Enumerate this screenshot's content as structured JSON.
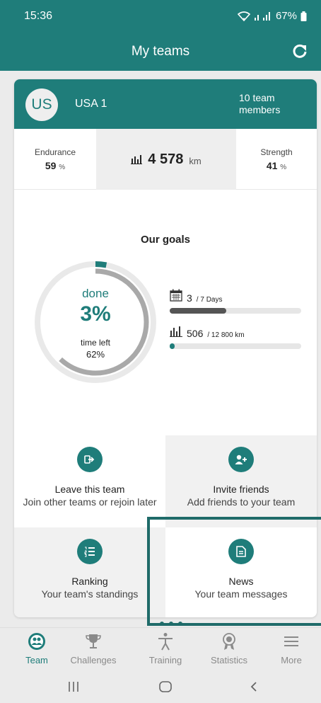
{
  "status_bar": {
    "time": "15:36",
    "battery": "67%"
  },
  "app_bar": {
    "title": "My teams",
    "refresh_icon": "refresh-icon"
  },
  "team": {
    "initials": "US",
    "name": "USA 1",
    "members": "10 team members"
  },
  "stats": {
    "endurance": {
      "label": "Endurance",
      "value": "59",
      "unit": "%"
    },
    "distance": {
      "value": "4 578",
      "unit": "km"
    },
    "strength": {
      "label": "Strength",
      "value": "41",
      "unit": "%"
    }
  },
  "goals": {
    "title": "Our goals",
    "done_label": "done",
    "done_percent": "3%",
    "done_fraction": 0.03,
    "time_left_label": "time left",
    "time_left_percent": "62%",
    "time_left_fraction": 0.62,
    "days": {
      "value": "3",
      "total": "/ 7 Days",
      "fraction": 0.43
    },
    "km": {
      "value": "506",
      "total": "/ 12 800 km",
      "fraction": 0.04
    }
  },
  "actions": [
    {
      "title": "Leave this team",
      "subtitle": "Join other teams or rejoin later",
      "icon": "leave-icon"
    },
    {
      "title": "Invite friends",
      "subtitle": "Add friends to your team",
      "icon": "add-user-icon"
    },
    {
      "title": "Ranking",
      "subtitle": "Your team's standings",
      "icon": "ranking-list-icon"
    },
    {
      "title": "News",
      "subtitle": "Your team messages",
      "icon": "document-icon"
    }
  ],
  "bottom_nav": [
    {
      "label": "Team",
      "icon": "team-icon",
      "active": true
    },
    {
      "label": "Challenges",
      "icon": "trophy-icon",
      "active": false
    },
    {
      "label": "Training",
      "icon": "person-icon",
      "active": false
    },
    {
      "label": "Statistics",
      "icon": "medal-icon",
      "active": false
    },
    {
      "label": "More",
      "icon": "menu-icon",
      "active": false
    }
  ],
  "colors": {
    "accent": "#1f7d7a",
    "highlight": "#1f6b69",
    "progress_dark": "#555555"
  }
}
